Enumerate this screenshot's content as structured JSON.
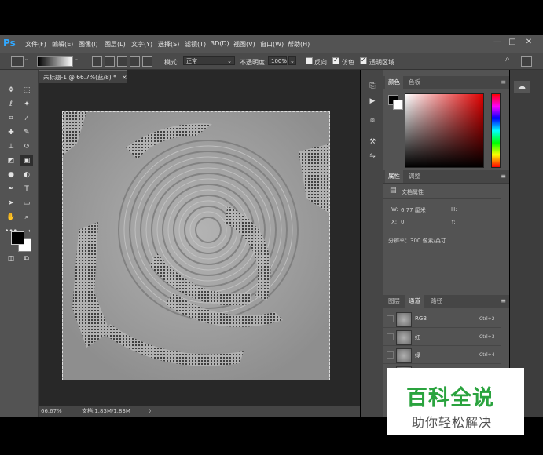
{
  "app": {
    "logo": "Ps"
  },
  "menu": [
    "文件(F)",
    "编辑(E)",
    "图像(I)",
    "图层(L)",
    "文字(Y)",
    "选择(S)",
    "滤镜(T)",
    "3D(D)",
    "视图(V)",
    "窗口(W)",
    "帮助(H)"
  ],
  "window_controls": [
    "—",
    "□",
    "✕"
  ],
  "options": {
    "mode_label": "模式:",
    "mode_value": "正常",
    "opacity_label": "不透明度:",
    "opacity_value": "100%",
    "reverse_label": "反向",
    "dither_label": "仿色",
    "transparency_label": "透明区域",
    "reverse_checked": false,
    "dither_checked": true,
    "transparency_checked": true
  },
  "document": {
    "tab_title": "未标题-1 @ 66.7%(蓝/8) *",
    "tab_close": "×",
    "zoom": "66.67%",
    "doc_info": "文档:1.83M/1.83M",
    "status_arrow": "〉"
  },
  "color_panel": {
    "tabs": [
      "颜色",
      "色板"
    ]
  },
  "properties_panel": {
    "tabs": [
      "属性",
      "调整"
    ],
    "section": "文档属性",
    "w_label": "W:",
    "w_value": "6.77 厘米",
    "h_label": "H:",
    "x_label": "X:",
    "x_value": "0",
    "y_label": "Y:",
    "resolution": "分辨率：300 像素/英寸"
  },
  "layers_panel": {
    "tabs": [
      "图层",
      "通道",
      "路径"
    ],
    "channels": [
      {
        "name": "RGB",
        "shortcut": "Ctrl+2"
      },
      {
        "name": "红",
        "shortcut": "Ctrl+3"
      },
      {
        "name": "绿",
        "shortcut": "Ctrl+4"
      }
    ]
  },
  "watermark": {
    "title": "百科全说",
    "subtitle": "助你轻松解决"
  },
  "colors": {
    "accent": "#31a8ff",
    "watermark_green": "#2aa33e",
    "ui_bg": "#535353"
  },
  "tool_icons": [
    "move-icon",
    "marquee-icon",
    "lasso-icon",
    "magic-wand-icon",
    "crop-icon",
    "eyedropper-icon",
    "healing-icon",
    "brush-icon",
    "stamp-icon",
    "history-brush-icon",
    "eraser-icon",
    "gradient-icon",
    "blur-icon",
    "dodge-icon",
    "pen-icon",
    "type-icon",
    "path-select-icon",
    "shape-icon",
    "hand-icon",
    "zoom-icon",
    "more-icon"
  ]
}
